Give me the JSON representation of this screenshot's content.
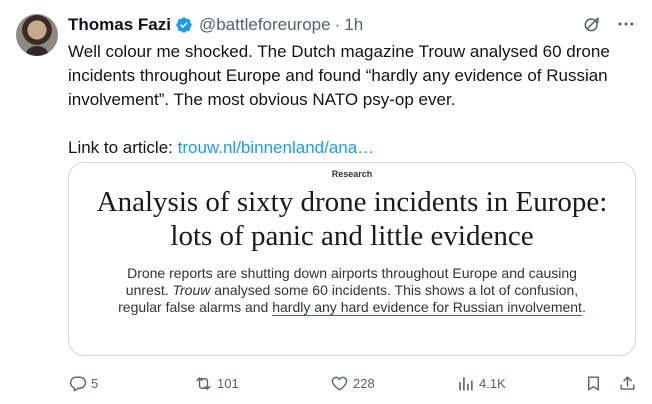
{
  "tweet": {
    "author_name": "Thomas Fazi",
    "handle": "@battleforeurope",
    "separator": "·",
    "time": "1h",
    "text_paragraph": "Well colour me shocked. The Dutch magazine Trouw analysed 60 drone incidents throughout Europe and found “hardly any evidence of Russian involvement”. The most obvious NATO psy-op ever.",
    "link_label": "Link to article: ",
    "link_text": "trouw.nl/binnenland/ana…"
  },
  "card": {
    "kicker": "Research",
    "title_line1": "Analysis of sixty drone incidents in Europe:",
    "title_line2": "lots of panic and little evidence",
    "body_part1": "Drone reports are shutting down airports throughout Europe and causing unrest. ",
    "body_italic": "Trouw",
    "body_part2": " analysed some 60 incidents. This shows a lot of confusion, regular false alarms and ",
    "body_underlined": "hardly any hard evidence for Russian involvement",
    "body_end": "."
  },
  "actions": {
    "replies": "5",
    "reposts": "101",
    "likes": "228",
    "views": "4.1K"
  },
  "icons": {
    "verified": "verified-badge-icon",
    "grok": "grok-icon",
    "more": "more-icon",
    "reply": "reply-icon",
    "repost": "repost-icon",
    "like": "heart-icon",
    "views": "views-icon",
    "bookmark": "bookmark-icon",
    "share": "share-icon"
  },
  "colors": {
    "text": "#0f1419",
    "secondary": "#536471",
    "link": "#1d9bf0",
    "verified": "#1d9bf0",
    "card_border": "#cfd9de"
  }
}
